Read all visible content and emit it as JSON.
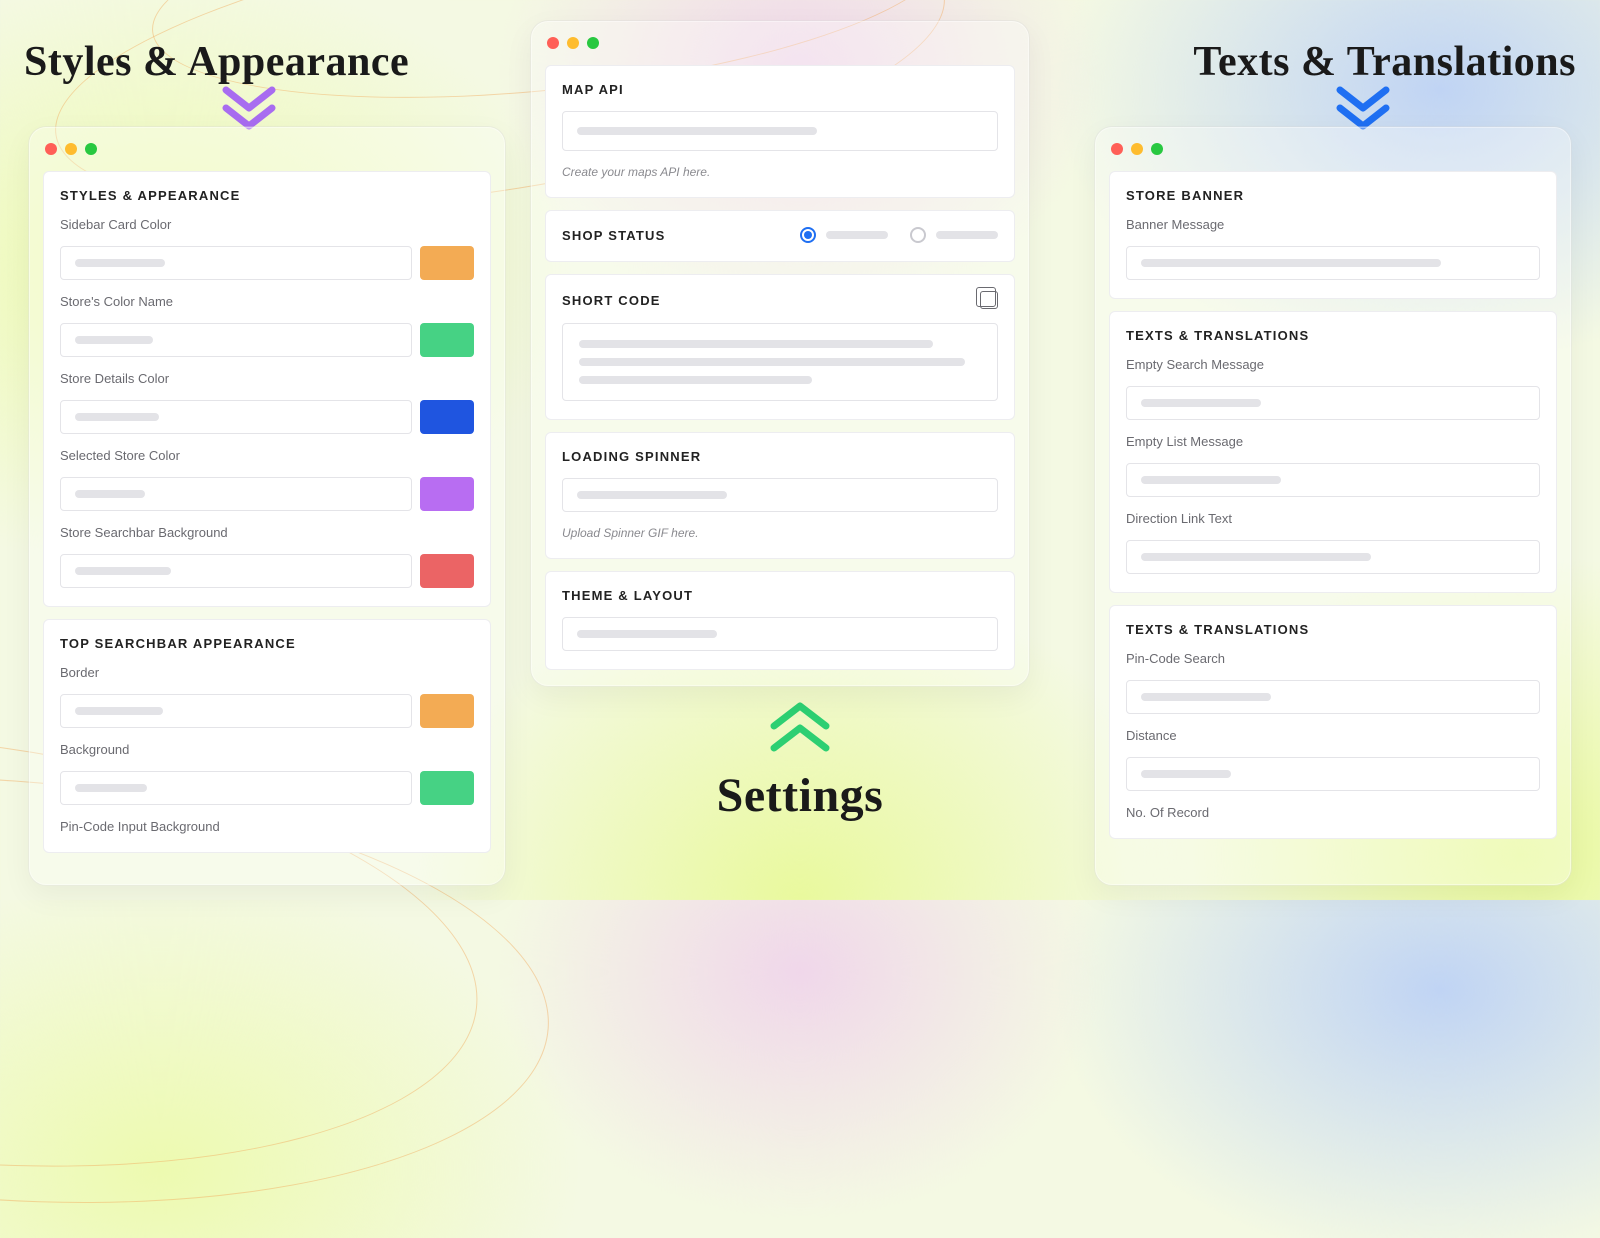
{
  "titles": {
    "left": "Styles & Appearance",
    "center": "Settings",
    "right": "Texts & Translations"
  },
  "colors": {
    "orange": "#f3ab54",
    "green": "#46d284",
    "blue": "#1f55e0",
    "purple": "#b86df2",
    "red": "#eb6465"
  },
  "left": {
    "cards": [
      {
        "title": "STYLES & APPEARANCE",
        "fields": [
          {
            "label": "Sidebar Card Color",
            "swatch": "orange"
          },
          {
            "label": "Store's Color Name",
            "swatch": "green"
          },
          {
            "label": "Store Details Color",
            "swatch": "blue"
          },
          {
            "label": "Selected Store Color",
            "swatch": "purple"
          },
          {
            "label": "Store Searchbar Background",
            "swatch": "red"
          }
        ]
      },
      {
        "title": "TOP SEARCHBAR APPEARANCE",
        "fields": [
          {
            "label": "Border",
            "swatch": "orange"
          },
          {
            "label": "Background",
            "swatch": "green"
          },
          {
            "label": "Pin-Code Input Background"
          }
        ]
      }
    ]
  },
  "center": {
    "map_api": {
      "title": "MAP API",
      "hint": "Create your maps API here."
    },
    "shop_status": {
      "title": "SHOP STATUS"
    },
    "short_code": {
      "title": "SHORT CODE"
    },
    "loading": {
      "title": "LOADING SPINNER",
      "hint": "Upload Spinner GIF here."
    },
    "theme": {
      "title": "THEME & LAYOUT"
    }
  },
  "right": {
    "cards": [
      {
        "title": "STORE BANNER",
        "fields": [
          {
            "label": "Banner Message"
          }
        ]
      },
      {
        "title": "TEXTS & TRANSLATIONS",
        "fields": [
          {
            "label": "Empty Search Message"
          },
          {
            "label": "Empty List Message"
          },
          {
            "label": "Direction Link Text"
          }
        ]
      },
      {
        "title": "TEXTS & TRANSLATIONS",
        "fields": [
          {
            "label": "Pin-Code Search"
          },
          {
            "label": "Distance"
          },
          {
            "label": "No. Of Record"
          }
        ]
      }
    ]
  }
}
